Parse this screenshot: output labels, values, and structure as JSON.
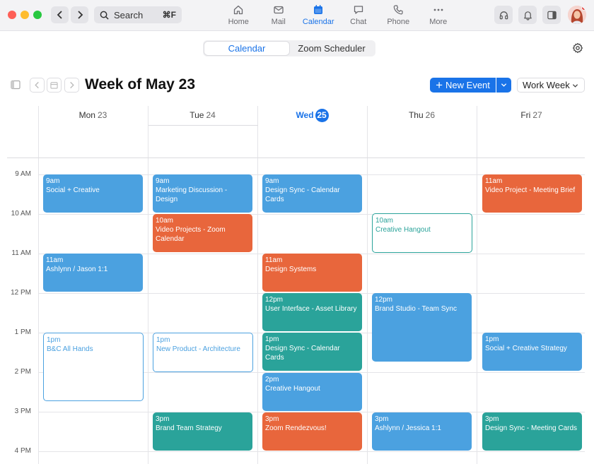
{
  "titlebar": {
    "search_placeholder": "Search",
    "search_shortcut": "⌘F",
    "tabs": [
      {
        "label": "Home",
        "icon": "home-icon"
      },
      {
        "label": "Mail",
        "icon": "mail-icon"
      },
      {
        "label": "Calendar",
        "icon": "calendar-icon",
        "active": true
      },
      {
        "label": "Chat",
        "icon": "chat-icon"
      },
      {
        "label": "Phone",
        "icon": "phone-icon"
      },
      {
        "label": "More",
        "icon": "more-icon"
      }
    ]
  },
  "subheader": {
    "segments": [
      "Calendar",
      "Zoom Scheduler"
    ],
    "active_segment": "Calendar"
  },
  "toolbar": {
    "week_title": "Week of May 23",
    "new_event_label": "New Event",
    "view_label": "Work Week"
  },
  "days": [
    {
      "name": "Mon",
      "num": "23"
    },
    {
      "name": "Tue",
      "num": "24"
    },
    {
      "name": "Wed",
      "num": "25",
      "today": true
    },
    {
      "name": "Thu",
      "num": "26"
    },
    {
      "name": "Fri",
      "num": "27"
    }
  ],
  "time_labels": [
    "9 AM",
    "10 AM",
    "11 AM",
    "12 PM",
    "1 PM",
    "2 PM",
    "3 PM",
    "4 PM"
  ],
  "events": {
    "mon": [
      {
        "time": "9am",
        "title": "Social + Creative"
      },
      {
        "time": "11am",
        "title": "Ashlynn / Jason 1:1"
      },
      {
        "time": "1pm",
        "title": "B&C All Hands"
      }
    ],
    "tue": [
      {
        "time": "9am",
        "title": "Marketing Discussion - Design"
      },
      {
        "time": "10am",
        "title": "Video Projects - Zoom Calendar"
      },
      {
        "time": "1pm",
        "title": "New Product - Architecture"
      },
      {
        "time": "3pm",
        "title": "Brand Team Strategy"
      }
    ],
    "wed": [
      {
        "time": "9am",
        "title": "Design Sync - Calendar Cards"
      },
      {
        "time": "11am",
        "title": "Design Systems"
      },
      {
        "time": "12pm",
        "title": "User Interface - Asset Library"
      },
      {
        "time": "1pm",
        "title": "Design Sync - Calendar Cards"
      },
      {
        "time": "2pm",
        "title": "Creative Hangout"
      },
      {
        "time": "3pm",
        "title": "Zoom Rendezvous!"
      }
    ],
    "thu": [
      {
        "time": "10am",
        "title": "Creative Hangout"
      },
      {
        "time": "12pm",
        "title": "Brand Studio - Team Sync"
      },
      {
        "time": "3pm",
        "title": "Ashlynn / Jessica 1:1"
      }
    ],
    "fri": [
      {
        "time": "11am",
        "title": "Video Project - Meeting Brief"
      },
      {
        "time": "1pm",
        "title": "Social + Creative Strategy"
      },
      {
        "time": "3pm",
        "title": "Design Sync - Meeting Cards"
      }
    ]
  },
  "colors": {
    "accent": "#1a73e8",
    "event_blue": "#4ba1e0",
    "event_orange": "#e8663c",
    "event_teal": "#2aa39a"
  }
}
